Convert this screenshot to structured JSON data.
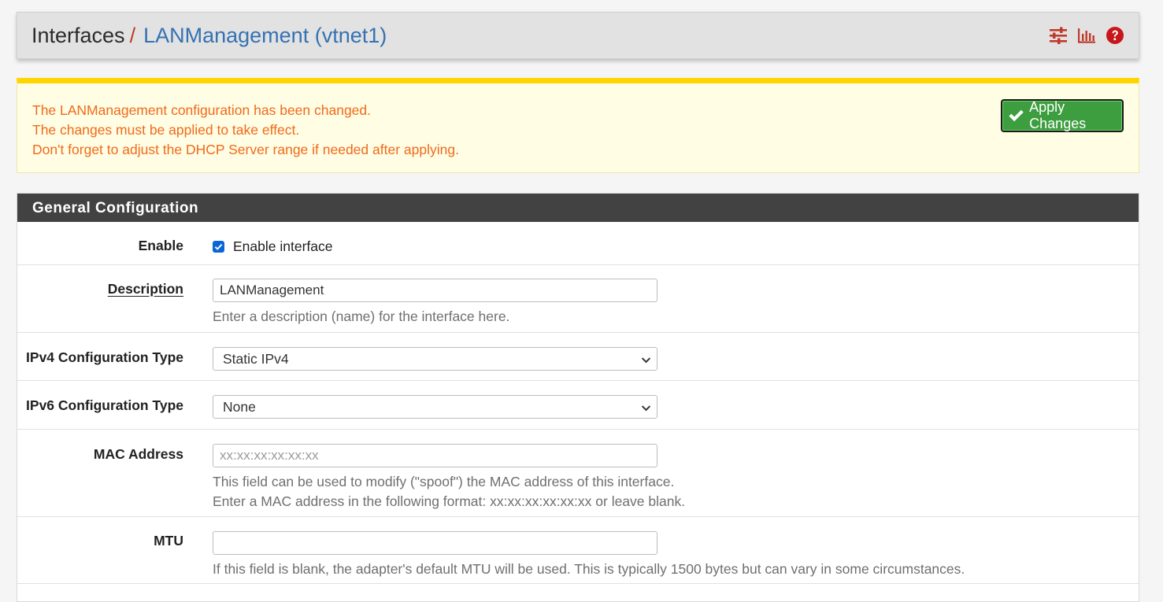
{
  "header": {
    "crumb_root": "Interfaces",
    "crumb_separator": "/",
    "crumb_current": "LANManagement (vtnet1)",
    "icons": [
      "sliders-icon",
      "bar-chart-icon",
      "help-icon"
    ],
    "icon_color": "#c0392b"
  },
  "alert": {
    "lines": [
      "The LANManagement configuration has been changed.",
      "The changes must be applied to take effect.",
      "Don't forget to adjust the DHCP Server range if needed after applying."
    ],
    "button_label": "Apply Changes",
    "text_color": "#f06a1c",
    "border_color": "#ffd500",
    "button_color": "#3c9e3e"
  },
  "panel": {
    "title": "General Configuration",
    "enable": {
      "label": "Enable",
      "checkbox_label": "Enable interface",
      "checked": true
    },
    "description": {
      "label": "Description",
      "value": "LANManagement",
      "help": "Enter a description (name) for the interface here."
    },
    "ipv4": {
      "label": "IPv4 Configuration Type",
      "selected": "Static IPv4"
    },
    "ipv6": {
      "label": "IPv6 Configuration Type",
      "selected": "None"
    },
    "mac": {
      "label": "MAC Address",
      "value": "",
      "placeholder": "xx:xx:xx:xx:xx:xx",
      "help_lines": [
        "This field can be used to modify (\"spoof\") the MAC address of this interface.",
        "Enter a MAC address in the following format: xx:xx:xx:xx:xx:xx or leave blank."
      ]
    },
    "mtu": {
      "label": "MTU",
      "value": "",
      "help": "If this field is blank, the adapter's default MTU will be used. This is typically 1500 bytes but can vary in some circumstances."
    }
  }
}
